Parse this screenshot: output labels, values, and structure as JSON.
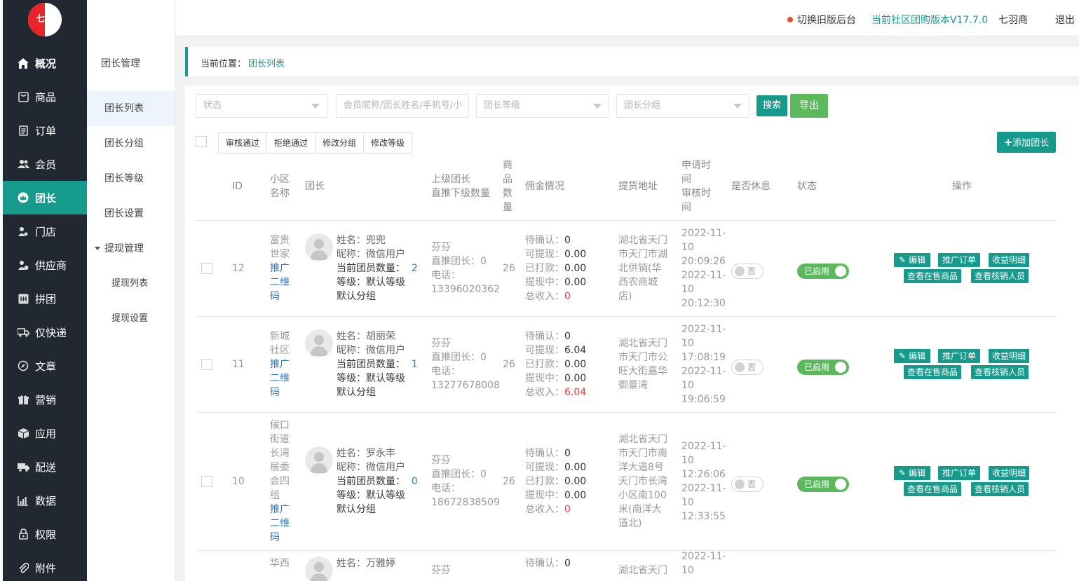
{
  "app": {
    "logo_text": "七羽"
  },
  "topbar": {
    "switch_label": "切换旧版后台",
    "version_label": "当前社区团购版本V17.7.0",
    "user": "七羽商",
    "logout": "退出"
  },
  "nav": {
    "items": [
      {
        "label": "概况",
        "icon": "home-icon"
      },
      {
        "label": "商品",
        "icon": "goods-icon"
      },
      {
        "label": "订单",
        "icon": "order-icon"
      },
      {
        "label": "会员",
        "icon": "member-icon"
      },
      {
        "label": "团长",
        "icon": "crown-icon"
      },
      {
        "label": "门店",
        "icon": "store-icon"
      },
      {
        "label": "供应商",
        "icon": "supplier-icon"
      },
      {
        "label": "拼团",
        "icon": "group-icon"
      },
      {
        "label": "仅快递",
        "icon": "truck-icon"
      },
      {
        "label": "文章",
        "icon": "compass-icon"
      },
      {
        "label": "营销",
        "icon": "gift-icon"
      },
      {
        "label": "应用",
        "icon": "cube-icon"
      },
      {
        "label": "配送",
        "icon": "delivery-icon"
      },
      {
        "label": "数据",
        "icon": "chart-icon"
      },
      {
        "label": "权限",
        "icon": "lock-icon"
      },
      {
        "label": "附件",
        "icon": "paperclip-icon"
      }
    ]
  },
  "subnav": {
    "section": "团长管理",
    "items": [
      "团长列表",
      "团长分组",
      "团长等级",
      "团长设置"
    ],
    "withdraw_section": "提现管理",
    "withdraw_items": [
      "提现列表",
      "提现设置"
    ]
  },
  "breadcrumb": {
    "prefix": "当前位置：",
    "current": "团长列表"
  },
  "filters": {
    "status_placeholder": "状态",
    "keyword_placeholder": "会员昵称/团长姓名/手机号/小",
    "level_placeholder": "团长等级",
    "group_placeholder": "团长分组",
    "search_label": "搜索",
    "export_label": "导出"
  },
  "batch": {
    "approve": "审核通过",
    "reject": "拒绝通过",
    "change_group": "修改分组",
    "change_level": "修改等级"
  },
  "add_button": "添加团长",
  "table": {
    "headers": {
      "id": "ID",
      "community": [
        "小区",
        "名称"
      ],
      "leader": "团长",
      "parent": [
        "上级团长",
        "直推下级数量"
      ],
      "goods": [
        "商",
        "品",
        "数",
        "量"
      ],
      "commission": "佣金情况",
      "address": "提货地址",
      "time": [
        "申请时",
        "间",
        "审核时",
        "间"
      ],
      "rest": "是否休息",
      "status": "状态",
      "ops": "操作"
    },
    "labels": {
      "name": "姓名：",
      "nickname": "昵称：",
      "members": "当前团员数量：",
      "level": "等级：",
      "direct": "直推团长：",
      "phone": "电话：",
      "pending": "待确认：",
      "withdrawable": "可提现：",
      "paid": "已打款：",
      "withdrawing": "提现中：",
      "income": "总收入：",
      "qr_link": [
        "推广",
        "二维",
        "码"
      ]
    },
    "rows": [
      {
        "id": "12",
        "community": [
          "富贵",
          "世家"
        ],
        "name": "兜兜",
        "nickname": "微信用户",
        "members": "2",
        "level": "默认等级",
        "group": "默认分组",
        "parent_name": "芬芬",
        "direct": "0",
        "phone": "13396020362",
        "goods": "26",
        "pending": "0",
        "withdrawable": "0.00",
        "paid": "0.00",
        "withdrawing": "0.00",
        "income": "0",
        "address": [
          "湖北省天门",
          "市天门市湖",
          "北供销(华",
          "西农商城",
          "店)"
        ],
        "time": [
          "2022-11-",
          "10",
          "20:09:26",
          "2022-11-",
          "10",
          "20:12:30"
        ],
        "rest": "否",
        "status": "已启用"
      },
      {
        "id": "11",
        "community": [
          "新城",
          "社区"
        ],
        "name": "胡丽荣",
        "nickname": "微信用户",
        "members": "1",
        "level": "默认等级",
        "group": "默认分组",
        "parent_name": "芬芬",
        "direct": "0",
        "phone": "13277678008",
        "goods": "26",
        "pending": "0",
        "withdrawable": "6.04",
        "paid": "0.00",
        "withdrawing": "0.00",
        "income": "6.04",
        "address": [
          "湖北省天门",
          "市天门市公",
          "旺大街嘉华",
          "御景湾"
        ],
        "time": [
          "2022-11-",
          "10",
          "17:08:19",
          "2022-11-",
          "10",
          "19:06:59"
        ],
        "rest": "否",
        "status": "已启用"
      },
      {
        "id": "10",
        "community": [
          "候口",
          "街道",
          "长湾",
          "居委",
          "会四",
          "组"
        ],
        "name": "罗永丰",
        "nickname": "微信用户",
        "members": "0",
        "level": "默认等级",
        "group": "默认分组",
        "parent_name": "芬芬",
        "direct": "0",
        "phone": "18672838509",
        "goods": "26",
        "pending": "0",
        "withdrawable": "0.00",
        "paid": "0.00",
        "withdrawing": "0.00",
        "income": "0",
        "address": [
          "湖北省天门",
          "市天门市南",
          "洋大道8号",
          "天门市长湾",
          "小区南100",
          "米(南洋大",
          "道北)"
        ],
        "time": [
          "2022-11-",
          "10",
          "12:26:06",
          "2022-11-",
          "10",
          "12:33:55"
        ],
        "rest": "否",
        "status": "已启用"
      },
      {
        "community": [
          "华西"
        ],
        "name": "万雅婷",
        "parent_name": "芬芬",
        "pending": "0",
        "address": [
          "湖北省天门"
        ],
        "time": [
          "2022-11-",
          "10"
        ]
      }
    ],
    "ops": {
      "edit": "编辑",
      "promo_orders": "推广订单",
      "income_detail": "收益明细",
      "goods_on_sale": "查看在售商品",
      "verifiers": "查看核销人员"
    }
  },
  "colors": {
    "accent": "#159a8c",
    "sidebar": "#222831",
    "link": "#2b7bd2",
    "switch_on": "#5cb85c",
    "income_red": "#e23b3b"
  }
}
